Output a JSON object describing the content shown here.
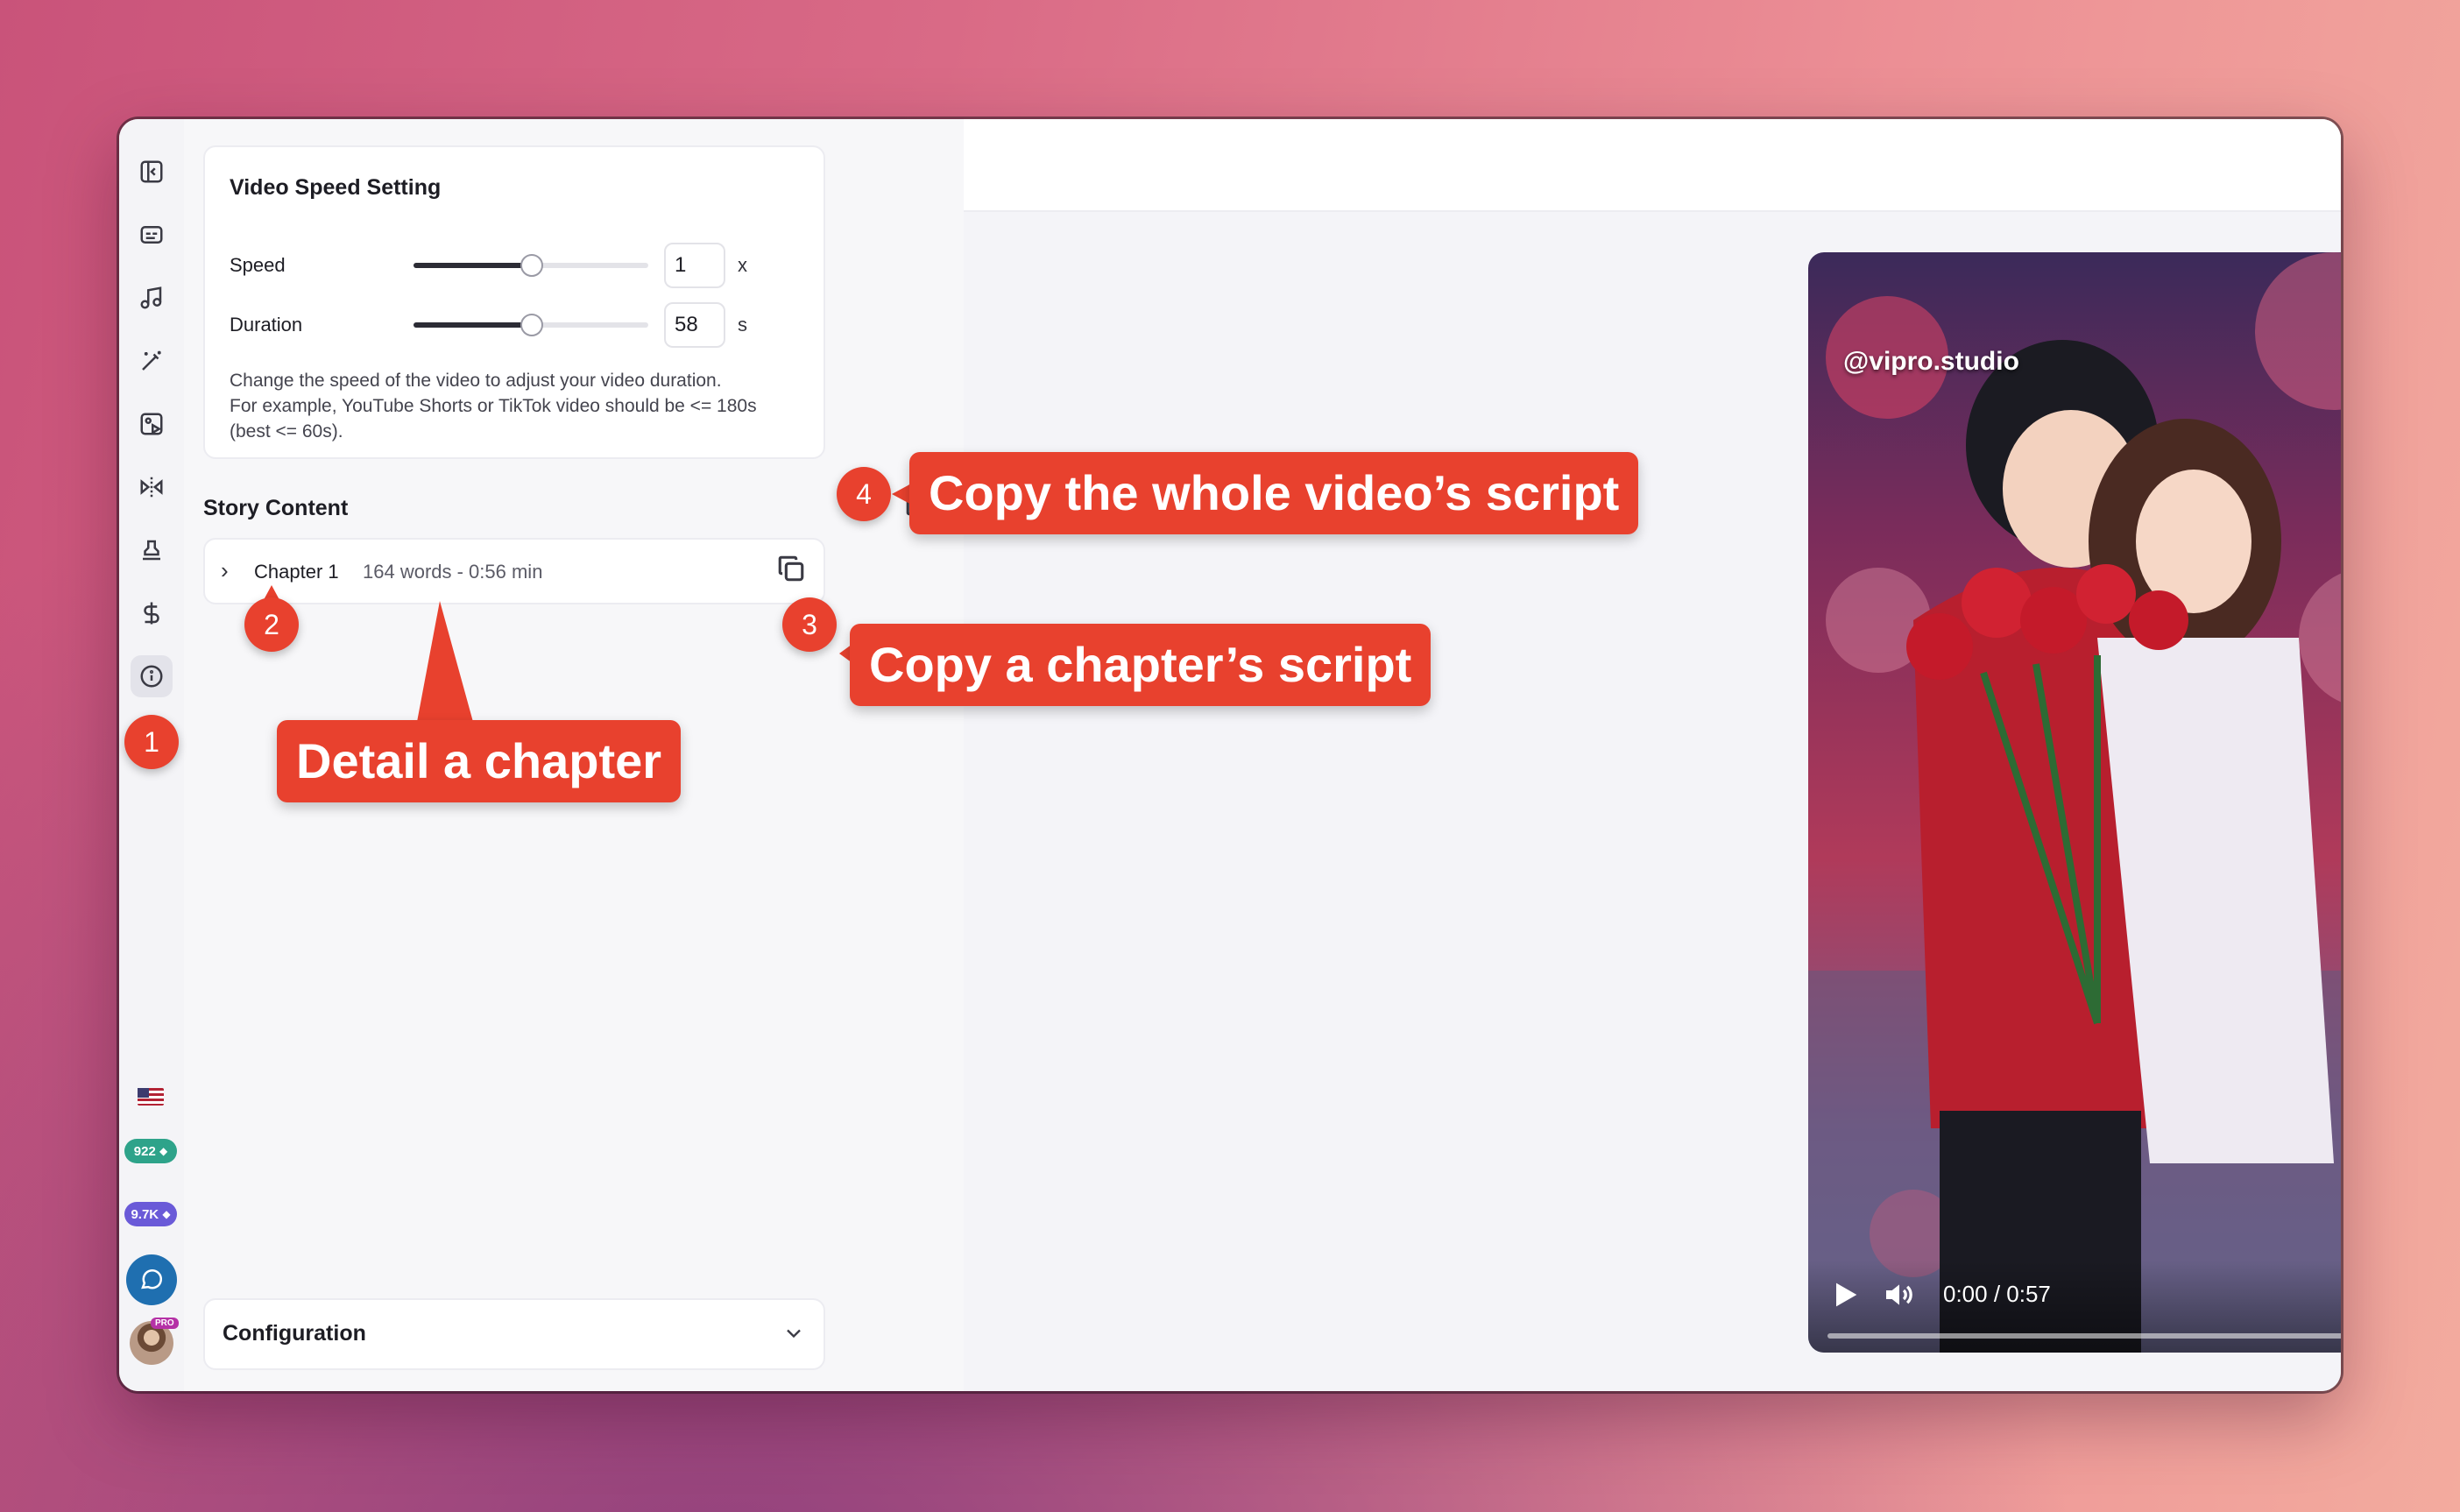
{
  "speed_panel": {
    "title": "Video Speed Setting",
    "speed_label": "Speed",
    "speed_value": "1",
    "speed_unit": "x",
    "speed_fraction": 0.5,
    "duration_label": "Duration",
    "duration_value": "58",
    "duration_unit": "s",
    "duration_fraction": 0.5,
    "help_lines": [
      "Change the speed of the video to adjust your video duration.",
      "For example, YouTube Shorts or TikTok video should be <= 180s",
      "(best <= 60s)."
    ]
  },
  "story": {
    "title": "Story Content",
    "chapter_name": "Chapter 1",
    "chapter_meta": "164 words - 0:56 min"
  },
  "config": {
    "title": "Configuration"
  },
  "rail": {
    "icons": [
      "collapse-sidebar-icon",
      "subtitles-icon",
      "music-icon",
      "magic-wand-icon",
      "image-video-icon",
      "transition-icon",
      "stamp-icon",
      "dollar-icon",
      "info-icon"
    ],
    "credits_1": "922",
    "credits_2": "9.7K",
    "pro_badge": "PRO"
  },
  "video": {
    "watermark": "@vipro.studio",
    "time": "0:00 / 0:57",
    "progress": 0
  },
  "annotations": {
    "b1": "1",
    "b2": "2",
    "b3": "3",
    "b4": "4",
    "detail_chapter": "Detail a chapter",
    "copy_chapter": "Copy a chapter’s script",
    "copy_whole": "Copy the whole video’s script"
  },
  "colors": {
    "accent": "#e8412e",
    "chip_green": "#2ea38a",
    "chip_purple": "#6a5ad8",
    "chat_blue": "#1f6fb0"
  }
}
